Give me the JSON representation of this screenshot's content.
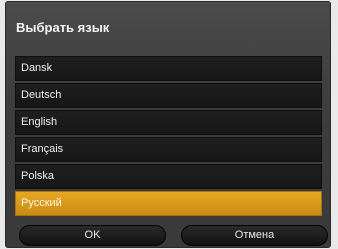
{
  "dialog": {
    "title": "Выбрать язык"
  },
  "languages": [
    {
      "label": "Dansk",
      "selected": false
    },
    {
      "label": "Deutsch",
      "selected": false
    },
    {
      "label": "English",
      "selected": false
    },
    {
      "label": "Français",
      "selected": false
    },
    {
      "label": "Polska",
      "selected": false
    },
    {
      "label": "Русский",
      "selected": true
    }
  ],
  "buttons": {
    "ok_label": "OK",
    "cancel_label": "Отмена"
  },
  "colors": {
    "selected_accent": "#d9981a",
    "dialog_background": "#3d3d3d"
  }
}
